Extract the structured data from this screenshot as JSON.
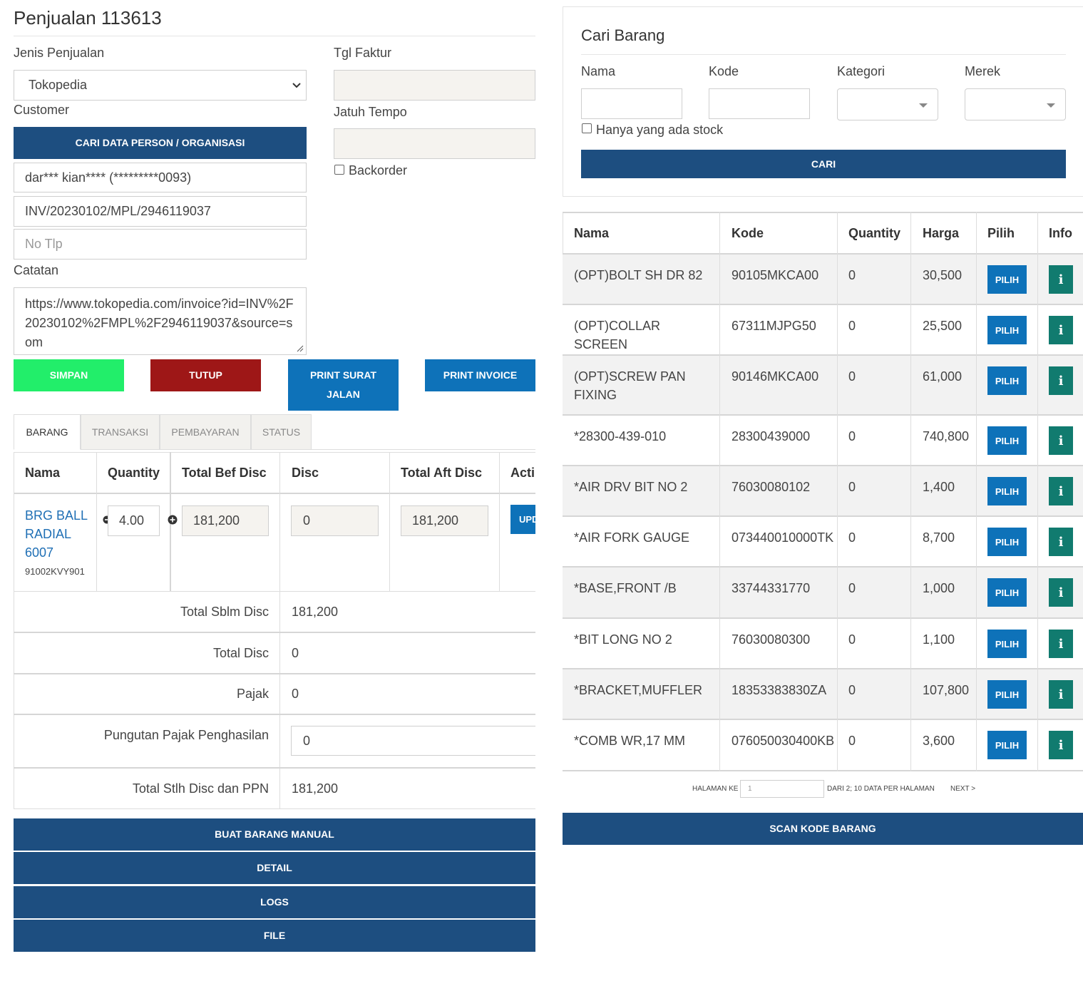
{
  "page_title": "Penjualan 113613",
  "form": {
    "jenis_label": "Jenis Penjualan",
    "jenis_value": "Tokopedia",
    "customer_label": "Customer",
    "cari_person_button": "CARI DATA PERSON / ORGANISASI",
    "customer_name": "dar*** kian**** (*********0093)",
    "invoice_no": "INV/20230102/MPL/2946119037",
    "phone_placeholder": "No Tlp",
    "catatan_label": "Catatan",
    "catatan_value": "https://www.tokopedia.com/invoice?id=INV%2F20230102%2FMPL%2F2946119037&source=som",
    "tgl_faktur_label": "Tgl Faktur",
    "jatuh_tempo_label": "Jatuh Tempo",
    "backorder_label": "Backorder"
  },
  "actions": {
    "simpan": "SIMPAN",
    "tutup": "TUTUP",
    "print_surat_jalan": "PRINT SURAT JALAN",
    "print_invoice": "PRINT INVOICE"
  },
  "tabs": [
    {
      "label": "BARANG",
      "active": true
    },
    {
      "label": "TRANSAKSI",
      "active": false
    },
    {
      "label": "PEMBAYARAN",
      "active": false
    },
    {
      "label": "STATUS",
      "active": false
    }
  ],
  "cart": {
    "headers": [
      "Nama",
      "Quantity",
      "Total Bef Disc",
      "Disc",
      "Total Aft Disc",
      "Acti"
    ],
    "item": {
      "name": "BRG BALL RADIAL 6007",
      "code": "91002KVY901",
      "quantity": "4.00",
      "total_bef_disc": "181,200",
      "disc": "0",
      "total_aft_disc": "181,200",
      "action": "UPD"
    },
    "summary": {
      "total_sblm_disc_label": "Total Sblm Disc",
      "total_sblm_disc": "181,200",
      "total_disc_label": "Total Disc",
      "total_disc": "0",
      "pajak_label": "Pajak",
      "pajak": "0",
      "pph_label": "Pungutan Pajak Penghasilan",
      "pph": "0",
      "total_stlh_label": "Total Stlh Disc dan PPN",
      "total_stlh": "181,200"
    }
  },
  "bottom_buttons": {
    "buat_barang_manual": "BUAT BARANG MANUAL",
    "detail": "DETAIL",
    "logs": "LOGS",
    "file": "FILE"
  },
  "search": {
    "title": "Cari Barang",
    "nama_label": "Nama",
    "kode_label": "Kode",
    "kategori_label": "Kategori",
    "merek_label": "Merek",
    "stock_only_label": "Hanya yang ada stock",
    "cari_button": "CARI"
  },
  "products": {
    "headers": [
      "Nama",
      "Kode",
      "Quantity",
      "Harga",
      "Pilih",
      "Info"
    ],
    "pilih_label": "PILIH",
    "info_label": "i",
    "rows": [
      {
        "nama": "(OPT)BOLT SH DR 82",
        "kode": "90105MKCA00",
        "qty": "0",
        "harga": "30,500"
      },
      {
        "nama": "(OPT)COLLAR SCREEN",
        "kode": "67311MJPG50",
        "qty": "0",
        "harga": "25,500"
      },
      {
        "nama": "(OPT)SCREW PAN FIXING",
        "kode": "90146MKCA00",
        "qty": "0",
        "harga": "61,000"
      },
      {
        "nama": "*28300-439-010",
        "kode": "28300439000",
        "qty": "0",
        "harga": "740,800"
      },
      {
        "nama": "*AIR DRV BIT NO 2",
        "kode": "76030080102",
        "qty": "0",
        "harga": "1,400"
      },
      {
        "nama": "*AIR FORK GAUGE",
        "kode": "073440010000TK",
        "qty": "0",
        "harga": "8,700"
      },
      {
        "nama": "*BASE,FRONT /B",
        "kode": "33744331770",
        "qty": "0",
        "harga": "1,000"
      },
      {
        "nama": "*BIT LONG NO 2",
        "kode": "76030080300",
        "qty": "0",
        "harga": "1,100"
      },
      {
        "nama": "*BRACKET,MUFFLER",
        "kode": "18353383830ZA",
        "qty": "0",
        "harga": "107,800"
      },
      {
        "nama": "*COMB WR,17 MM",
        "kode": "076050030400KB",
        "qty": "0",
        "harga": "3,600"
      }
    ]
  },
  "pagination": {
    "halaman_ke_label": "HALAMAN KE",
    "page_value": "1",
    "info": "DARI 2; 10 DATA PER HALAMAN",
    "next": "NEXT >"
  },
  "scan_button": "SCAN KODE BARANG"
}
